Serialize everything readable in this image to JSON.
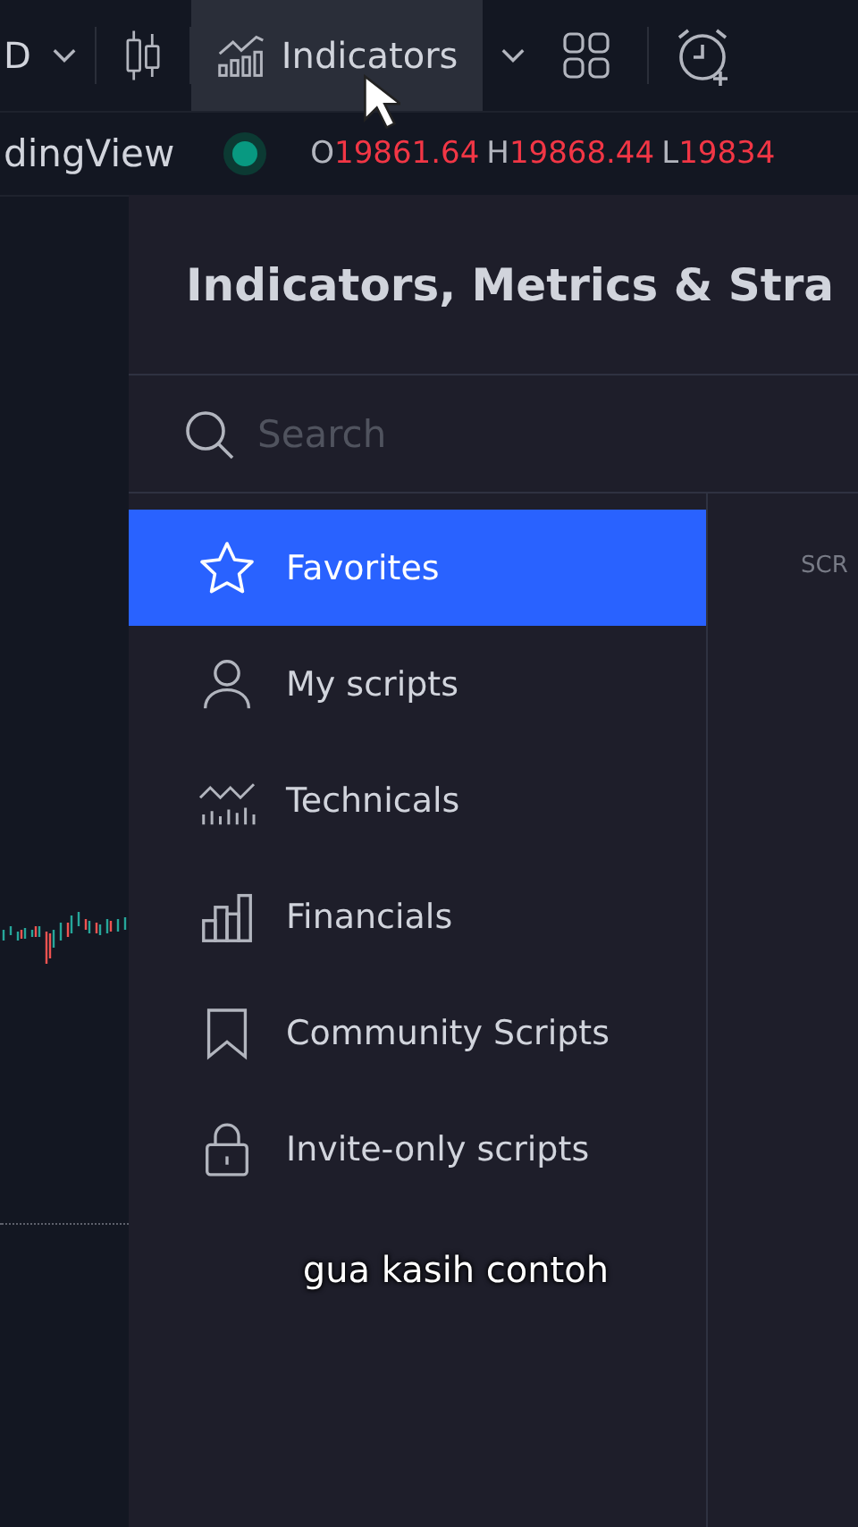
{
  "toolbar": {
    "interval": "D",
    "indicators_button": {
      "label": "Indicators",
      "selected": true
    }
  },
  "symbol_bar": {
    "name": "dingView",
    "ohlc": [
      {
        "key": "O",
        "value": "19861.64"
      },
      {
        "key": "H",
        "value": "19868.44"
      },
      {
        "key": "L",
        "value": "19834"
      }
    ]
  },
  "dialog": {
    "title": "Indicators, Metrics & Stra",
    "search": {
      "placeholder": "Search"
    },
    "sidebar": {
      "items": [
        {
          "label": "Favorites",
          "kind": "star",
          "selected": true
        },
        {
          "label": "My scripts",
          "kind": "person",
          "selected": false
        },
        {
          "label": "Technicals",
          "kind": "technicals",
          "selected": false
        },
        {
          "label": "Financials",
          "kind": "financials",
          "selected": false
        },
        {
          "label": "Community Scripts",
          "kind": "bookmark",
          "selected": false
        },
        {
          "label": "Invite-only scripts",
          "kind": "lock",
          "selected": false
        }
      ]
    },
    "content_heading": "SCR"
  },
  "subtitle": "gua kasih contoh"
}
